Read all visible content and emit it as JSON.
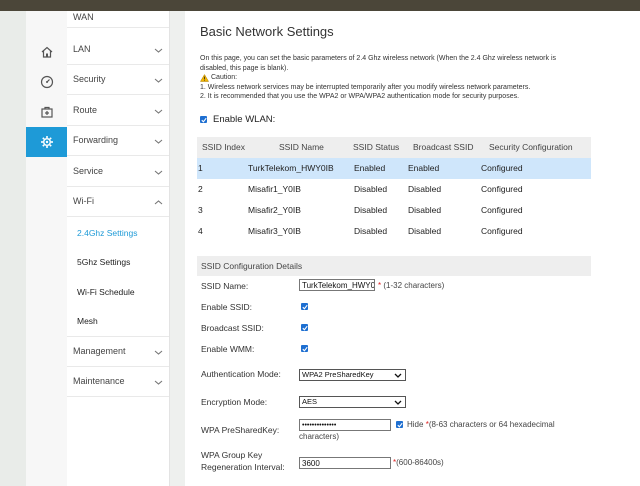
{
  "sidebar": {
    "icons": [
      {
        "name": "home-icon"
      },
      {
        "name": "dashboard-icon"
      },
      {
        "name": "toolbox-icon"
      },
      {
        "name": "gear-icon"
      }
    ],
    "menu": {
      "wan": "WAN",
      "lan": "LAN",
      "security": "Security",
      "route": "Route",
      "forwarding": "Forwarding",
      "service": "Service",
      "wifi": "Wi-Fi",
      "management": "Management",
      "maintenance": "Maintenance"
    },
    "wifi_subitems": [
      "2.4Ghz Settings",
      "5Ghz Settings",
      "Wi-Fi Schedule",
      "Mesh"
    ]
  },
  "page": {
    "title": "Basic Network Settings",
    "intro_line1": "On this page, you can set the basic parameters of 2.4 Ghz wireless network (When the 2.4 Ghz wireless network is",
    "intro_line2": "disabled, this page is blank).",
    "caution_label": "Caution:",
    "caution_1": "1. Wireless network services may be interrupted temporarily after you modify wireless network parameters.",
    "caution_2": "2. It is recommended that you use the WPA2 or WPA/WPA2 authentication mode for security purposes.",
    "enable_wlan_label": "Enable WLAN:"
  },
  "ssid_table": {
    "headers": [
      "SSID Index",
      "SSID Name",
      "SSID Status",
      "Broadcast SSID",
      "Security Configuration"
    ],
    "rows": [
      [
        "1",
        "TurkTelekom_HWY0IB",
        "Enabled",
        "Enabled",
        "Configured"
      ],
      [
        "2",
        "Misafir1_Y0IB",
        "Disabled",
        "Disabled",
        "Configured"
      ],
      [
        "3",
        "Misafir2_Y0IB",
        "Disabled",
        "Disabled",
        "Configured"
      ],
      [
        "4",
        "Misafir3_Y0IB",
        "Disabled",
        "Disabled",
        "Configured"
      ]
    ]
  },
  "config": {
    "section_title": "SSID Configuration Details",
    "ssid_name_label": "SSID Name:",
    "ssid_name_value": "TurkTelekom_HWY0",
    "ssid_name_hint": "(1-32 characters)",
    "enable_ssid_label": "Enable SSID:",
    "broadcast_ssid_label": "Broadcast SSID:",
    "enable_wmm_label": "Enable WMM:",
    "auth_mode_label": "Authentication Mode:",
    "auth_mode_value": "WPA2 PreSharedKey",
    "encryption_mode_label": "Encryption Mode:",
    "encryption_mode_value": "AES",
    "psk_label": "WPA PreSharedKey:",
    "psk_value": "••••••••••••••",
    "hide_label": "Hide",
    "psk_hint_1": "(8-63 characters or 64 hexadecimal",
    "psk_hint_2": "characters)",
    "group_key_label_1": "WPA Group Key",
    "group_key_label_2": "Regeneration Interval:",
    "group_key_value": "3600",
    "group_key_hint": "(600-86400s)",
    "required_mark": "*"
  },
  "colors": {
    "accent": "#1e9ad7",
    "selected_row": "#cfe6fb",
    "checkbox": "#1e6fd1",
    "required": "#e02020"
  }
}
